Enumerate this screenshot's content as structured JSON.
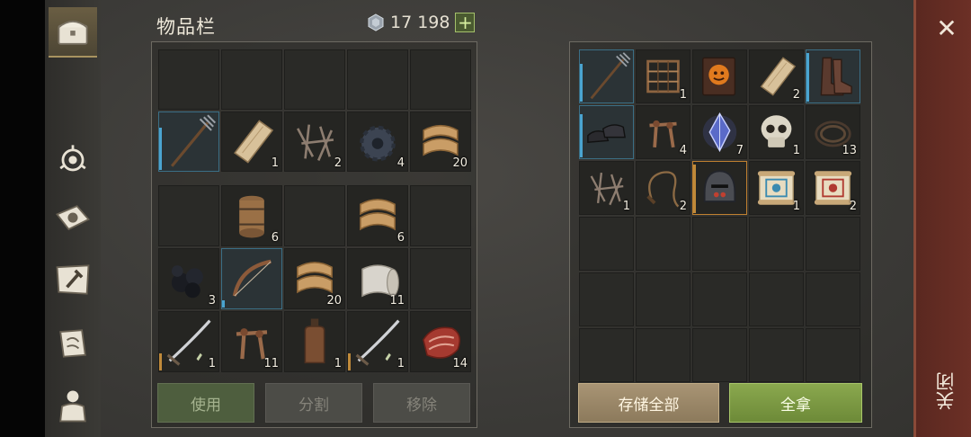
{
  "title": "物品栏",
  "currency": {
    "icon": "silver-coin-icon",
    "amount": "17 198",
    "add_label": "+"
  },
  "sidebar": {
    "items": [
      {
        "name": "chest-icon",
        "active": true
      },
      {
        "name": "crafting-emblem-icon",
        "active": false
      },
      {
        "name": "sun-book-icon",
        "active": false
      },
      {
        "name": "hammer-map-icon",
        "active": false
      },
      {
        "name": "scroll-quill-icon",
        "active": false
      },
      {
        "name": "backpack-character-icon",
        "active": false
      }
    ]
  },
  "inventory": {
    "equip_rows": [
      [
        {
          "item": "empty"
        },
        {
          "item": "empty"
        },
        {
          "item": "empty"
        },
        {
          "item": "empty"
        },
        {
          "item": "empty"
        }
      ],
      [
        {
          "item": "pitchfork",
          "count": "",
          "bar": 0.7,
          "bar_color": "blue"
        },
        {
          "item": "wood-plank",
          "count": "1"
        },
        {
          "item": "nails",
          "count": "2"
        },
        {
          "item": "gear",
          "count": "4"
        },
        {
          "item": "fabric",
          "count": "20"
        }
      ]
    ],
    "bag_rows": [
      [
        {
          "item": "empty"
        },
        {
          "item": "barrel",
          "count": "6"
        },
        {
          "item": "empty"
        },
        {
          "item": "fabric",
          "count": "6"
        },
        {
          "item": "empty"
        }
      ],
      [
        {
          "item": "coal",
          "count": "3"
        },
        {
          "item": "bow",
          "count": "",
          "bar": 0.12,
          "bar_color": "blue"
        },
        {
          "item": "fabric",
          "count": "20"
        },
        {
          "item": "cloth-roll",
          "count": "11"
        },
        {
          "item": "empty"
        }
      ],
      [
        {
          "item": "sword",
          "count": "1",
          "bar": 0.28,
          "bar_color": "orange",
          "tag": "dagger"
        },
        {
          "item": "pegs",
          "count": "11"
        },
        {
          "item": "bottle",
          "count": "1"
        },
        {
          "item": "sword",
          "count": "1",
          "bar": 0.28,
          "bar_color": "orange",
          "tag": "dagger"
        },
        {
          "item": "meat",
          "count": "14"
        }
      ]
    ],
    "buttons": {
      "use": "使用",
      "split": "分割",
      "remove": "移除"
    }
  },
  "storage": {
    "rows": [
      [
        {
          "item": "pitchfork",
          "count": "",
          "bar": 0.7,
          "bar_color": "blue"
        },
        {
          "item": "loom",
          "count": "1"
        },
        {
          "item": "book",
          "count": ""
        },
        {
          "item": "wood-plank",
          "count": "2"
        },
        {
          "item": "boots",
          "count": "",
          "bar": 0.9,
          "bar_color": "blue"
        }
      ],
      [
        {
          "item": "shoes",
          "count": "",
          "bar": 0.8,
          "bar_color": "blue"
        },
        {
          "item": "pegs",
          "count": "4"
        },
        {
          "item": "crystal",
          "count": "7"
        },
        {
          "item": "skull",
          "count": "1"
        },
        {
          "item": "rope",
          "count": "13"
        }
      ],
      [
        {
          "item": "nails",
          "count": "1"
        },
        {
          "item": "whip",
          "count": "2"
        },
        {
          "item": "helmet",
          "count": "",
          "bar": 0.9,
          "bar_color": "orange"
        },
        {
          "item": "blue-scroll",
          "count": "1"
        },
        {
          "item": "red-scroll",
          "count": "2"
        }
      ],
      [
        {
          "item": "empty"
        },
        {
          "item": "empty"
        },
        {
          "item": "empty"
        },
        {
          "item": "empty"
        },
        {
          "item": "empty"
        }
      ],
      [
        {
          "item": "empty"
        },
        {
          "item": "empty"
        },
        {
          "item": "empty"
        },
        {
          "item": "empty"
        },
        {
          "item": "empty"
        }
      ],
      [
        {
          "item": "empty"
        },
        {
          "item": "empty"
        },
        {
          "item": "empty"
        },
        {
          "item": "empty"
        },
        {
          "item": "empty"
        }
      ]
    ],
    "buttons": {
      "store_all": "存储全部",
      "take_all": "全拿"
    }
  },
  "close": {
    "icon": "close-icon",
    "label": "关闭"
  }
}
